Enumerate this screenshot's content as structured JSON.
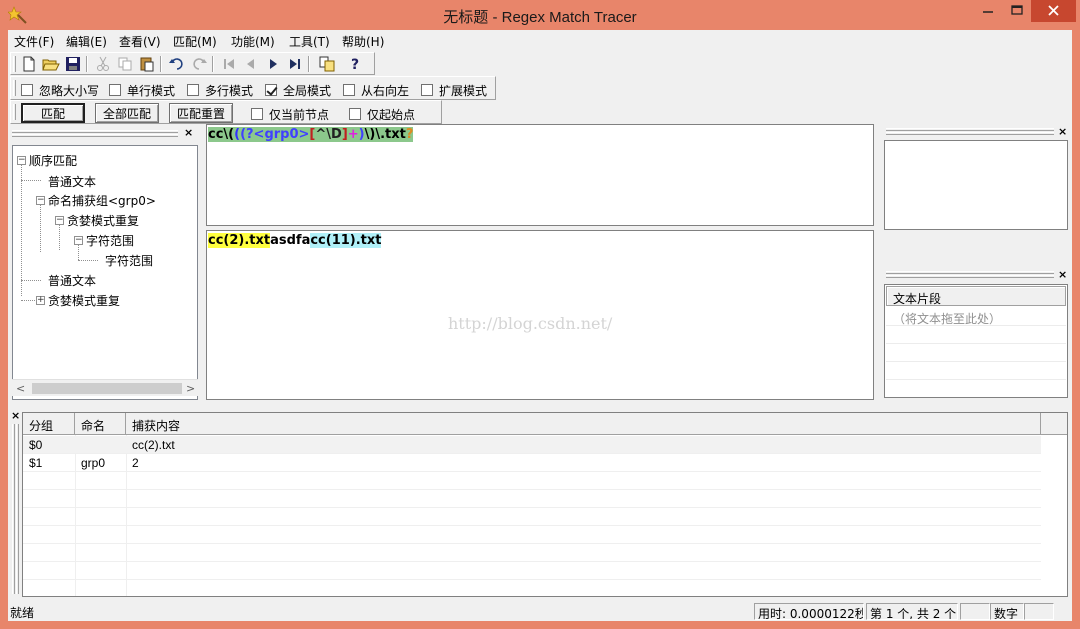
{
  "window": {
    "title": "无标题 - Regex Match Tracer"
  },
  "menu": [
    "文件(F)",
    "编辑(E)",
    "查看(V)",
    "匹配(M)",
    "功能(M)",
    "工具(T)",
    "帮助(H)"
  ],
  "toolbar_icons": [
    "new-file-icon",
    "open-folder-icon",
    "save-icon",
    "cut-icon",
    "copy-icon",
    "paste-icon",
    "undo-icon",
    "redo-icon",
    "first-icon",
    "previous-icon",
    "next-icon",
    "last-icon",
    "insert-icon",
    "help-icon"
  ],
  "options": [
    {
      "label": "忽略大小写",
      "checked": false
    },
    {
      "label": "单行模式",
      "checked": false
    },
    {
      "label": "多行模式",
      "checked": false
    },
    {
      "label": "全局模式",
      "checked": true
    },
    {
      "label": "从右向左",
      "checked": false
    },
    {
      "label": "扩展模式",
      "checked": false
    }
  ],
  "actions": {
    "match": "匹配",
    "match_all": "全部匹配",
    "reset": "匹配重置",
    "current_node_only": "仅当前节点",
    "start_only": "仅起始点"
  },
  "tree": {
    "root": "顺序匹配",
    "items": [
      "普通文本",
      "命名捕获组<grp0>",
      "贪婪模式重复",
      "字符范围",
      "字符范围",
      "普通文本",
      "贪婪模式重复"
    ]
  },
  "regex_tokens": [
    {
      "t": "cc",
      "c": "#000000",
      "bg": "#8cc88c"
    },
    {
      "t": "\\(",
      "c": "#000000",
      "bg": "#8cc88c"
    },
    {
      "t": "(",
      "c": "#3030ff",
      "bg": "#8cc88c"
    },
    {
      "t": "(?<grp0>",
      "c": "#4040ff",
      "bg": "#8cc88c"
    },
    {
      "t": "[",
      "c": "#c02020",
      "bg": "#8cc88c"
    },
    {
      "t": "^\\D",
      "c": "#202020",
      "bg": "#8cc88c"
    },
    {
      "t": "]",
      "c": "#c02020",
      "bg": "#8cc88c"
    },
    {
      "t": "+",
      "c": "#e020e0",
      "bg": "#8cc88c"
    },
    {
      "t": ")",
      "c": "#4040ff",
      "bg": "#8cc88c"
    },
    {
      "t": "\\)",
      "c": "#000000",
      "bg": "#8cc88c"
    },
    {
      "t": "\\.txt",
      "c": "#000000",
      "bg": "#8cc88c"
    },
    {
      "t": "?",
      "c": "#e08a20",
      "bg": "#8cc88c"
    }
  ],
  "text_segments": [
    {
      "t": "cc(2).txt",
      "bg": "#ffff40"
    },
    {
      "t": "asdfa",
      "bg": "#ffffff"
    },
    {
      "t": "cc(11).txt",
      "bg": "#b0f0f8"
    }
  ],
  "watermark": "http://blog.csdn.net/",
  "snippets": {
    "header": "文本片段",
    "placeholder": "（将文本拖至此处）"
  },
  "results": {
    "columns": [
      "分组",
      "命名",
      "捕获内容"
    ],
    "rows": [
      {
        "group": "$0",
        "name": "",
        "content": "cc(2).txt"
      },
      {
        "group": "$1",
        "name": "grp0",
        "content": "2"
      }
    ]
  },
  "status": {
    "ready": "就绪",
    "time": "用时: 0.0000122秒",
    "count": "第 1 个, 共 2 个",
    "mode": "数字"
  }
}
